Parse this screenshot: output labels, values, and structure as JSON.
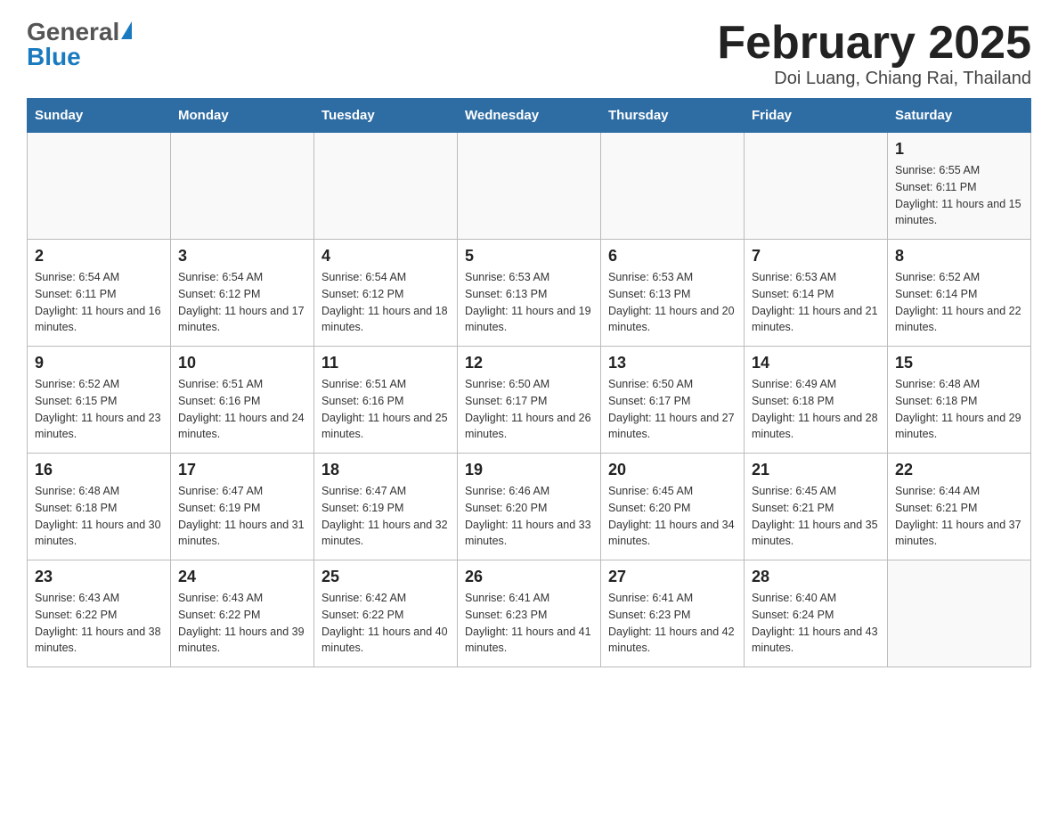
{
  "logo": {
    "general": "General",
    "blue": "Blue"
  },
  "header": {
    "month_year": "February 2025",
    "location": "Doi Luang, Chiang Rai, Thailand"
  },
  "weekdays": [
    "Sunday",
    "Monday",
    "Tuesday",
    "Wednesday",
    "Thursday",
    "Friday",
    "Saturday"
  ],
  "weeks": [
    [
      {
        "day": "",
        "info": ""
      },
      {
        "day": "",
        "info": ""
      },
      {
        "day": "",
        "info": ""
      },
      {
        "day": "",
        "info": ""
      },
      {
        "day": "",
        "info": ""
      },
      {
        "day": "",
        "info": ""
      },
      {
        "day": "1",
        "info": "Sunrise: 6:55 AM\nSunset: 6:11 PM\nDaylight: 11 hours and 15 minutes."
      }
    ],
    [
      {
        "day": "2",
        "info": "Sunrise: 6:54 AM\nSunset: 6:11 PM\nDaylight: 11 hours and 16 minutes."
      },
      {
        "day": "3",
        "info": "Sunrise: 6:54 AM\nSunset: 6:12 PM\nDaylight: 11 hours and 17 minutes."
      },
      {
        "day": "4",
        "info": "Sunrise: 6:54 AM\nSunset: 6:12 PM\nDaylight: 11 hours and 18 minutes."
      },
      {
        "day": "5",
        "info": "Sunrise: 6:53 AM\nSunset: 6:13 PM\nDaylight: 11 hours and 19 minutes."
      },
      {
        "day": "6",
        "info": "Sunrise: 6:53 AM\nSunset: 6:13 PM\nDaylight: 11 hours and 20 minutes."
      },
      {
        "day": "7",
        "info": "Sunrise: 6:53 AM\nSunset: 6:14 PM\nDaylight: 11 hours and 21 minutes."
      },
      {
        "day": "8",
        "info": "Sunrise: 6:52 AM\nSunset: 6:14 PM\nDaylight: 11 hours and 22 minutes."
      }
    ],
    [
      {
        "day": "9",
        "info": "Sunrise: 6:52 AM\nSunset: 6:15 PM\nDaylight: 11 hours and 23 minutes."
      },
      {
        "day": "10",
        "info": "Sunrise: 6:51 AM\nSunset: 6:16 PM\nDaylight: 11 hours and 24 minutes."
      },
      {
        "day": "11",
        "info": "Sunrise: 6:51 AM\nSunset: 6:16 PM\nDaylight: 11 hours and 25 minutes."
      },
      {
        "day": "12",
        "info": "Sunrise: 6:50 AM\nSunset: 6:17 PM\nDaylight: 11 hours and 26 minutes."
      },
      {
        "day": "13",
        "info": "Sunrise: 6:50 AM\nSunset: 6:17 PM\nDaylight: 11 hours and 27 minutes."
      },
      {
        "day": "14",
        "info": "Sunrise: 6:49 AM\nSunset: 6:18 PM\nDaylight: 11 hours and 28 minutes."
      },
      {
        "day": "15",
        "info": "Sunrise: 6:48 AM\nSunset: 6:18 PM\nDaylight: 11 hours and 29 minutes."
      }
    ],
    [
      {
        "day": "16",
        "info": "Sunrise: 6:48 AM\nSunset: 6:18 PM\nDaylight: 11 hours and 30 minutes."
      },
      {
        "day": "17",
        "info": "Sunrise: 6:47 AM\nSunset: 6:19 PM\nDaylight: 11 hours and 31 minutes."
      },
      {
        "day": "18",
        "info": "Sunrise: 6:47 AM\nSunset: 6:19 PM\nDaylight: 11 hours and 32 minutes."
      },
      {
        "day": "19",
        "info": "Sunrise: 6:46 AM\nSunset: 6:20 PM\nDaylight: 11 hours and 33 minutes."
      },
      {
        "day": "20",
        "info": "Sunrise: 6:45 AM\nSunset: 6:20 PM\nDaylight: 11 hours and 34 minutes."
      },
      {
        "day": "21",
        "info": "Sunrise: 6:45 AM\nSunset: 6:21 PM\nDaylight: 11 hours and 35 minutes."
      },
      {
        "day": "22",
        "info": "Sunrise: 6:44 AM\nSunset: 6:21 PM\nDaylight: 11 hours and 37 minutes."
      }
    ],
    [
      {
        "day": "23",
        "info": "Sunrise: 6:43 AM\nSunset: 6:22 PM\nDaylight: 11 hours and 38 minutes."
      },
      {
        "day": "24",
        "info": "Sunrise: 6:43 AM\nSunset: 6:22 PM\nDaylight: 11 hours and 39 minutes."
      },
      {
        "day": "25",
        "info": "Sunrise: 6:42 AM\nSunset: 6:22 PM\nDaylight: 11 hours and 40 minutes."
      },
      {
        "day": "26",
        "info": "Sunrise: 6:41 AM\nSunset: 6:23 PM\nDaylight: 11 hours and 41 minutes."
      },
      {
        "day": "27",
        "info": "Sunrise: 6:41 AM\nSunset: 6:23 PM\nDaylight: 11 hours and 42 minutes."
      },
      {
        "day": "28",
        "info": "Sunrise: 6:40 AM\nSunset: 6:24 PM\nDaylight: 11 hours and 43 minutes."
      },
      {
        "day": "",
        "info": ""
      }
    ]
  ]
}
